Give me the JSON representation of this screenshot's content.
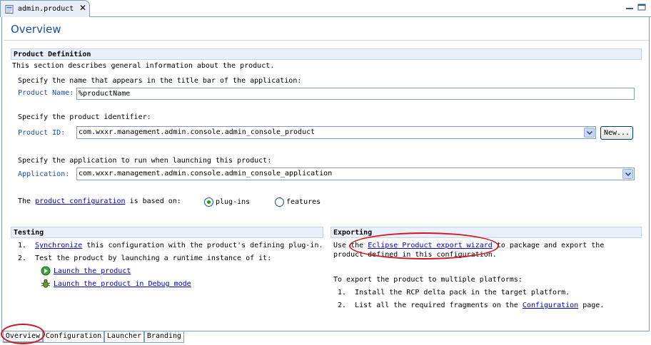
{
  "editor": {
    "tab_label": "admin.product",
    "icons": {
      "file": "product-file-icon",
      "close": "close-icon",
      "minimize": "minimize-icon",
      "maximize": "maximize-icon"
    }
  },
  "page": {
    "title": "Overview"
  },
  "product_definition": {
    "header": "Product Definition",
    "description": "This section describes general information about the product.",
    "name_prompt": "Specify the name that appears in the title bar of the application:",
    "name_label": "Product Name:",
    "name_value": "%productName",
    "id_prompt": "Specify the product identifier:",
    "id_label": "Product ID:",
    "id_value": "com.wxxr.management.admin.console.admin_console_product",
    "new_button": "New...",
    "app_prompt": "Specify the application to run when launching this product:",
    "app_label": "Application:",
    "app_value": "com.wxxr.management.admin.console.admin_console_application",
    "config_prefix": "The",
    "config_link": "product configuration",
    "config_suffix": "is based on:",
    "radio_plugins": "plug-ins",
    "radio_features": "features",
    "selected": "plug-ins"
  },
  "testing": {
    "header": "Testing",
    "item1_num": "1.",
    "item1_link": "Synchronize",
    "item1_text": "this configuration with the product's defining plug-in.",
    "item2_num": "2.",
    "item2_text": "Test the product by launching a runtime instance of it:",
    "launch_link": "Launch the product",
    "debug_link": "Launch the product in Debug mode",
    "icons": {
      "launch": "run-icon",
      "debug": "debug-icon"
    }
  },
  "exporting": {
    "header": "Exporting",
    "use_prefix": "Use the",
    "wizard_link": "Eclipse Product export wizard",
    "use_suffix": "to package and export the",
    "use_line2": "product defined in this configuration.",
    "multi_intro": "To export the product to multiple platforms:",
    "step1_num": "1.",
    "step1_text": "Install the RCP delta pack in the target platform.",
    "step2_num": "2.",
    "step2_prefix": "List all the required fragments on the",
    "step2_link": "Configuration",
    "step2_suffix": "page."
  },
  "page_tabs": [
    {
      "label": "Overview"
    },
    {
      "label": "Configuration"
    },
    {
      "label": "Launcher"
    },
    {
      "label": "Branding"
    }
  ],
  "colors": {
    "annotation": "#d4161c",
    "title": "#1f4ea6",
    "link": "#0000cc",
    "section_bg": "#e9f0fa"
  }
}
